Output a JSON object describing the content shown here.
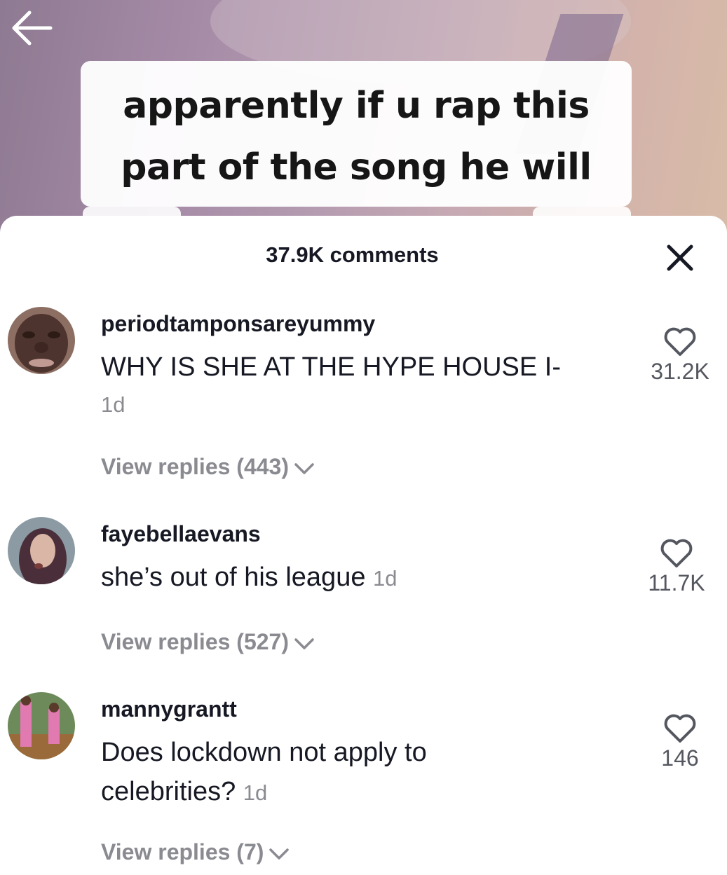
{
  "video": {
    "caption_line1": "apparently if u rap this",
    "caption_line2": "part of the song he will"
  },
  "sheet": {
    "title": "37.9K comments",
    "close_icon": "close-icon"
  },
  "comments": [
    {
      "username": "periodtamponsareyummy",
      "text": "WHY IS SHE AT THE HYPE HOUSE I-",
      "time": "1d",
      "likes": "31.2K",
      "replies": "View replies (443)",
      "avatar_color": "#6b4a3e"
    },
    {
      "username": "fayebellaevans",
      "text": "she’s out of his league",
      "time": "1d",
      "likes": "11.7K",
      "replies": "View replies (527)",
      "avatar_color": "#7a6a70"
    },
    {
      "username": "mannygrantt",
      "text_line1": "Does lockdown not apply to",
      "text_line2": "celebrities?",
      "time": "1d",
      "likes": "146",
      "replies": "View replies (7)",
      "avatar_color": "#8a6a3a"
    }
  ],
  "colors": {
    "text_primary": "#161823",
    "text_secondary": "#8a8b91"
  }
}
